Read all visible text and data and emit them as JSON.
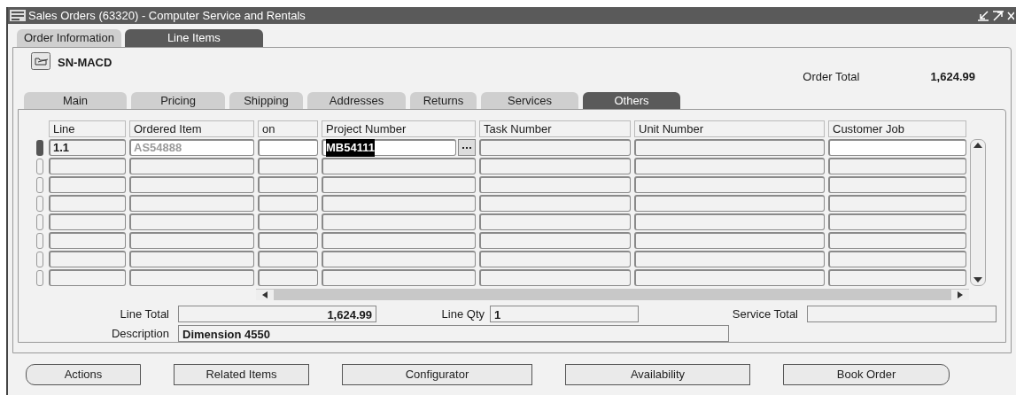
{
  "window": {
    "title": "Sales Orders (63320) - Computer Service and Rentals"
  },
  "tabs": [
    {
      "label": "Order Information",
      "selected": false
    },
    {
      "label": "Line Items",
      "selected": true
    }
  ],
  "header": {
    "order_number": "SN-MACD",
    "order_total_label": "Order Total",
    "order_total": "1,624.99"
  },
  "subtabs": [
    {
      "label": "Main",
      "selected": false
    },
    {
      "label": "Pricing",
      "selected": false
    },
    {
      "label": "Shipping",
      "selected": false
    },
    {
      "label": "Addresses",
      "selected": false
    },
    {
      "label": "Returns",
      "selected": false
    },
    {
      "label": "Services",
      "selected": false
    },
    {
      "label": "Others",
      "selected": true
    }
  ],
  "table": {
    "columns": [
      {
        "label": "Line",
        "editable": false
      },
      {
        "label": "Ordered Item",
        "editable": true
      },
      {
        "label": "on",
        "editable": true
      },
      {
        "label": "Project Number",
        "editable": true
      },
      {
        "label": "Task Number",
        "editable": false
      },
      {
        "label": "Unit Number",
        "editable": false
      },
      {
        "label": "Customer Job",
        "editable": true
      }
    ],
    "rows": [
      {
        "selected": true,
        "line": "1.1",
        "ordered_item": "AS54888",
        "ordered_item_disabled": true,
        "project_number": "MB54111",
        "project_number_highlighted": true
      },
      {
        "selected": false
      },
      {
        "selected": false
      },
      {
        "selected": false
      },
      {
        "selected": false
      },
      {
        "selected": false
      },
      {
        "selected": false
      },
      {
        "selected": false
      }
    ]
  },
  "totals": {
    "line_total_label": "Line Total",
    "line_total": "1,624.99",
    "line_qty_label": "Line Qty",
    "line_qty": "1",
    "service_total_label": "Service Total",
    "description_label": "Description",
    "description": "Dimension 4550"
  },
  "buttons": [
    "Actions",
    "Related Items",
    "Configurator",
    "Availability",
    "Book Order"
  ]
}
